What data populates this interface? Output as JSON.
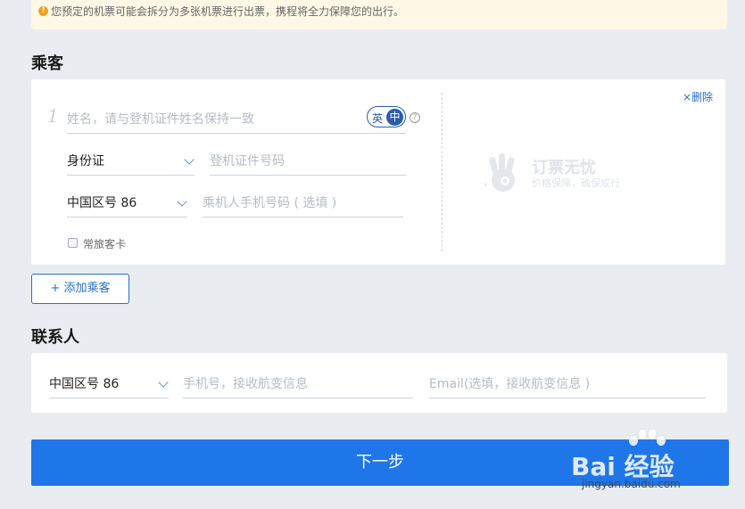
{
  "notice": {
    "text": "您预定的机票可能会拆分为多张机票进行出票，携程将全力保障您的出行。"
  },
  "passenger_section": {
    "title": "乘客",
    "index": "1",
    "name_placeholder": "姓名，请与登机证件姓名保持一致",
    "lang_en": "英",
    "lang_zh": "中",
    "help": "?",
    "id_type": "身份证",
    "id_number_placeholder": "登机证件号码",
    "phone_region": "中国区号 86",
    "phone_placeholder": "乘机人手机号码 ( 选填 )",
    "frequent_traveler_label": "常旅客卡",
    "delete_label": "删除",
    "delete_icon": "×",
    "brand_title": "订票无忧",
    "brand_subtitle": "价格保障，确保成行",
    "add_passenger_label": "+ 添加乘客"
  },
  "contact_section": {
    "title": "联系人",
    "phone_region": "中国区号 86",
    "phone_placeholder": "手机号，接收航变信息",
    "email_placeholder": "Email(选填，接收航变信息 )"
  },
  "next_button": "下一步",
  "watermark": {
    "text": "Bai 经验",
    "url": "jingyan.baidu.com"
  },
  "colors": {
    "accent": "#1f76e8",
    "link": "#2a6fc8",
    "background": "#e9edf2",
    "notice_bg": "#fff8e6"
  }
}
